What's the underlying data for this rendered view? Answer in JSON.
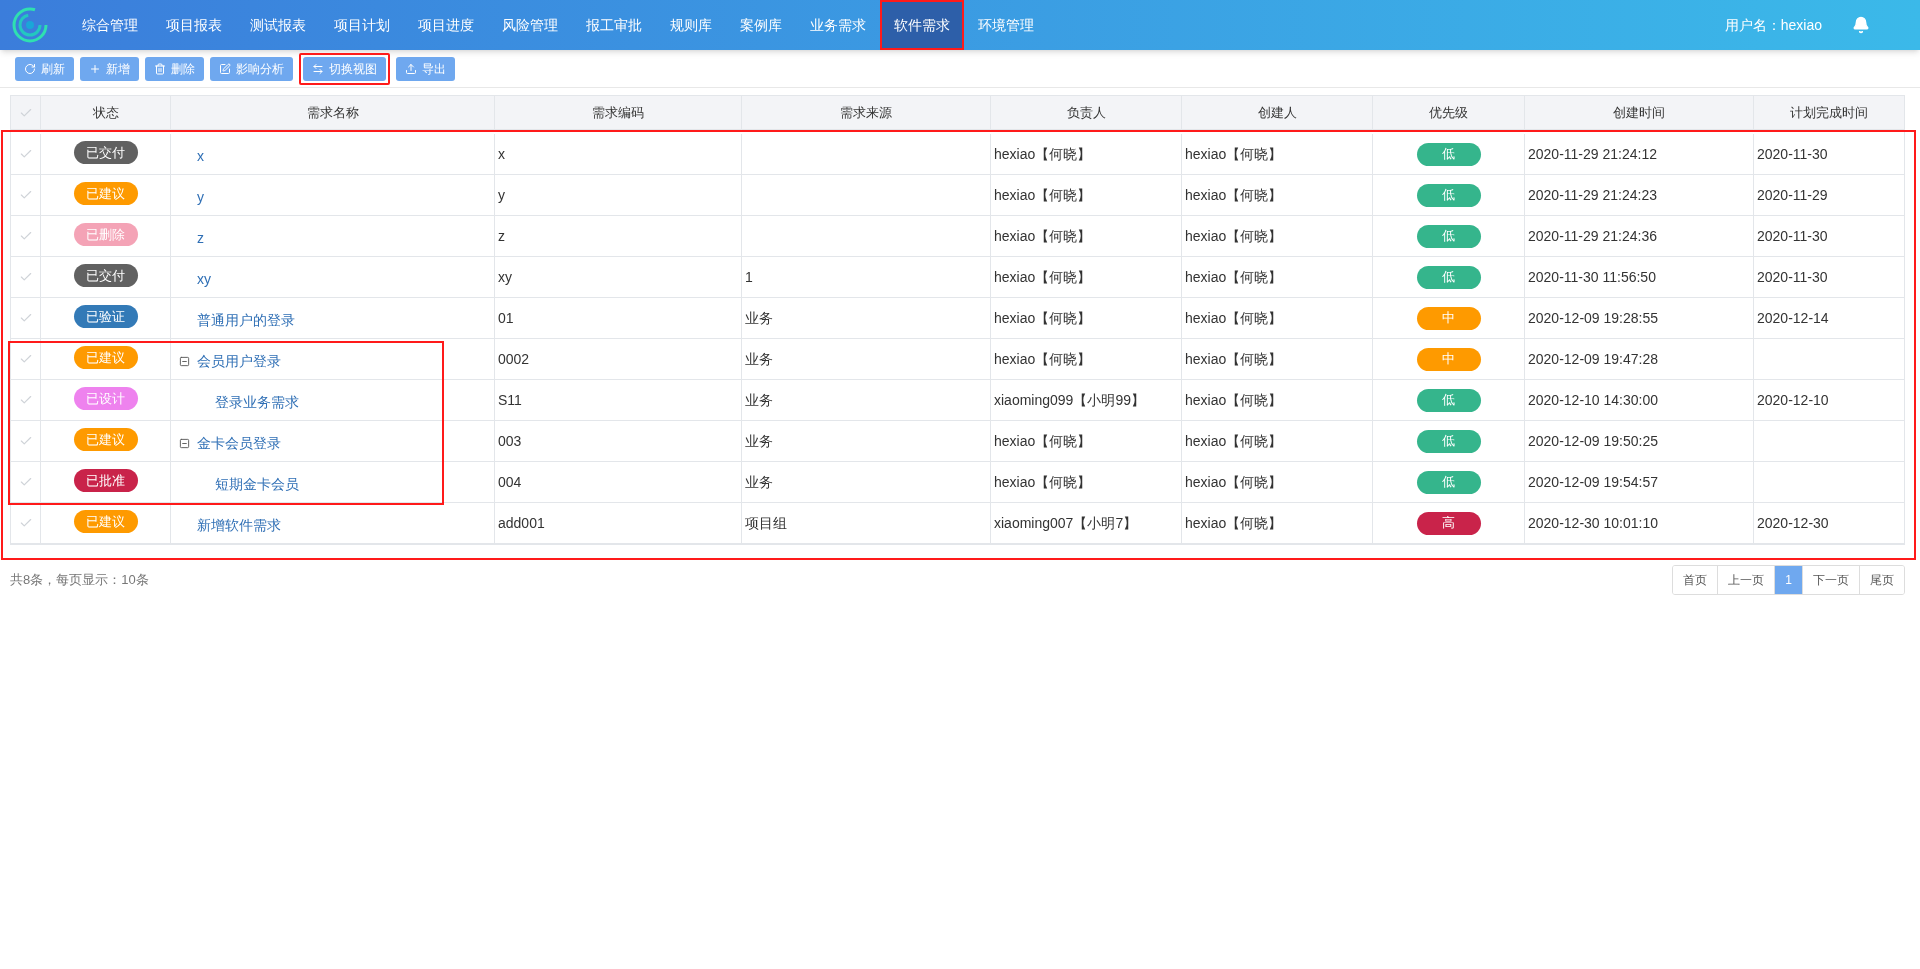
{
  "nav": {
    "items": [
      {
        "label": "综合管理",
        "selected": false,
        "highlighted": false
      },
      {
        "label": "项目报表",
        "selected": false,
        "highlighted": false
      },
      {
        "label": "测试报表",
        "selected": false,
        "highlighted": false
      },
      {
        "label": "项目计划",
        "selected": false,
        "highlighted": false
      },
      {
        "label": "项目进度",
        "selected": false,
        "highlighted": false
      },
      {
        "label": "风险管理",
        "selected": false,
        "highlighted": false
      },
      {
        "label": "报工审批",
        "selected": false,
        "highlighted": false
      },
      {
        "label": "规则库",
        "selected": false,
        "highlighted": false
      },
      {
        "label": "案例库",
        "selected": false,
        "highlighted": false
      },
      {
        "label": "业务需求",
        "selected": false,
        "highlighted": false
      },
      {
        "label": "软件需求",
        "selected": true,
        "highlighted": true
      },
      {
        "label": "环境管理",
        "selected": false,
        "highlighted": false
      }
    ],
    "user": "用户名：hexiao"
  },
  "toolbar": [
    {
      "kind": "refresh",
      "label": "刷新"
    },
    {
      "kind": "add",
      "label": "新增"
    },
    {
      "kind": "delete",
      "label": "删除"
    },
    {
      "kind": "analyze",
      "label": "影响分析"
    },
    {
      "kind": "switch",
      "label": "切换视图",
      "highlighted": true
    },
    {
      "kind": "export",
      "label": "导出"
    }
  ],
  "table": {
    "highlighted": true,
    "columns": [
      "状态",
      "需求名称",
      "需求编码",
      "需求来源",
      "负责人",
      "创建人",
      "优先级",
      "创建时间",
      "计划完成时间"
    ],
    "rows": [
      {
        "status": {
          "label": "已交付",
          "color": "#616161"
        },
        "name": "x",
        "code": "x",
        "owner": "hexiao【何晓】",
        "creator": "hexiao【何晓】",
        "priority": {
          "label": "低",
          "color": "#35b58c"
        },
        "created": "2020-11-29 21:24:12",
        "due": "2020-11-30"
      },
      {
        "status": {
          "label": "已建议",
          "color": "#fe9a00"
        },
        "name": "y",
        "code": "y",
        "owner": "hexiao【何晓】",
        "creator": "hexiao【何晓】",
        "priority": {
          "label": "低",
          "color": "#35b58c"
        },
        "created": "2020-11-29 21:24:23",
        "due": "2020-11-29"
      },
      {
        "status": {
          "label": "已删除",
          "color": "#f4a3b6"
        },
        "name": "z",
        "code": "z",
        "owner": "hexiao【何晓】",
        "creator": "hexiao【何晓】",
        "priority": {
          "label": "低",
          "color": "#35b58c"
        },
        "created": "2020-11-29 21:24:36",
        "due": "2020-11-30"
      },
      {
        "status": {
          "label": "已交付",
          "color": "#616161"
        },
        "name": "xy",
        "code": "xy",
        "source": "1",
        "owner": "hexiao【何晓】",
        "creator": "hexiao【何晓】",
        "priority": {
          "label": "低",
          "color": "#35b58c"
        },
        "created": "2020-11-30 11:56:50",
        "due": "2020-11-30"
      },
      {
        "status": {
          "label": "已验证",
          "color": "#337ab7"
        },
        "name": "普通用户的登录",
        "code": "01",
        "source": "业务",
        "owner": "hexiao【何晓】",
        "creator": "hexiao【何晓】",
        "priority": {
          "label": "中",
          "color": "#fe9a00"
        },
        "created": "2020-12-09 19:28:55",
        "due": "2020-12-14"
      },
      {
        "status": {
          "label": "已建议",
          "color": "#fe9a00"
        },
        "name": "会员用户登录",
        "code": "0002",
        "source": "业务",
        "owner": "hexiao【何晓】",
        "creator": "hexiao【何晓】",
        "priority": {
          "label": "中",
          "color": "#fe9a00"
        },
        "created": "2020-12-09 19:47:28",
        "highlighted": true,
        "expanded": true,
        "children": [
          {
            "status": {
              "label": "已设计",
              "color": "#ee82ee"
            },
            "name": "登录业务需求",
            "code": "S11",
            "source": "业务",
            "owner": "xiaoming099【小明99】",
            "creator": "hexiao【何晓】",
            "priority": {
              "label": "低",
              "color": "#35b58c"
            },
            "created": "2020-12-10 14:30:00",
            "due": "2020-12-10"
          }
        ]
      },
      {
        "status": {
          "label": "已建议",
          "color": "#fe9a00"
        },
        "name": "金卡会员登录",
        "code": "003",
        "source": "业务",
        "owner": "hexiao【何晓】",
        "creator": "hexiao【何晓】",
        "priority": {
          "label": "低",
          "color": "#35b58c"
        },
        "created": "2020-12-09 19:50:25",
        "highlighted": true,
        "expanded": true,
        "children": [
          {
            "status": {
              "label": "已批准",
              "color": "#c9234a"
            },
            "name": "短期金卡会员",
            "code": "004",
            "source": "业务",
            "owner": "hexiao【何晓】",
            "creator": "hexiao【何晓】",
            "priority": {
              "label": "低",
              "color": "#35b58c"
            },
            "created": "2020-12-09 19:54:57"
          }
        ]
      },
      {
        "status": {
          "label": "已建议",
          "color": "#fe9a00"
        },
        "name": "新增软件需求",
        "code": "add001",
        "source": "项目组",
        "owner": "xiaoming007【小明7】",
        "creator": "hexiao【何晓】",
        "priority": {
          "label": "高",
          "color": "#c9234a"
        },
        "created": "2020-12-30 10:01:10",
        "due": "2020-12-30"
      }
    ]
  },
  "footer": {
    "summary": "共8条，每页显示：10条",
    "pages": [
      {
        "label": "首页",
        "selected": false
      },
      {
        "label": "上一页",
        "selected": false
      },
      {
        "label": "1",
        "selected": true
      },
      {
        "label": "下一页",
        "selected": false
      },
      {
        "label": "尾页",
        "selected": false
      }
    ]
  }
}
